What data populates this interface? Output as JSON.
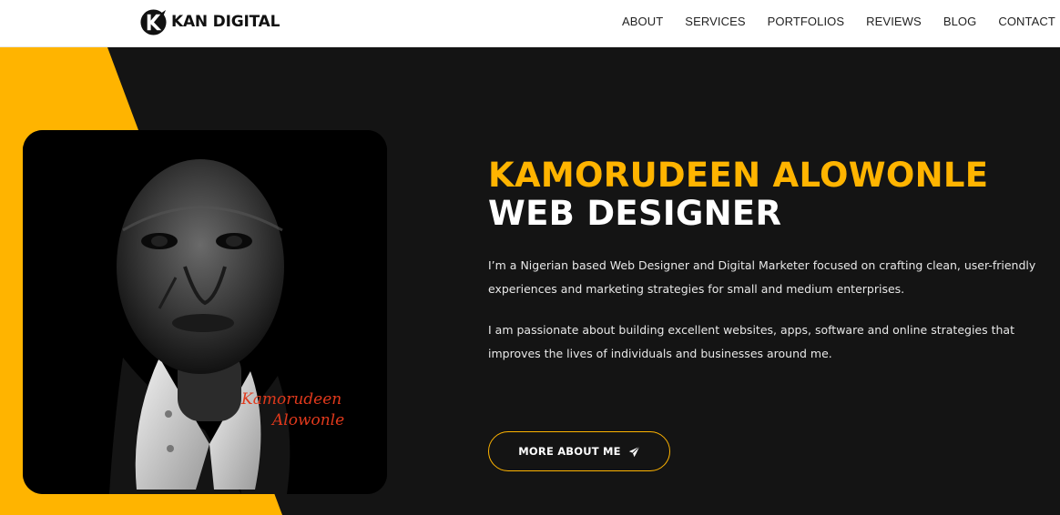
{
  "brand": {
    "name": "KAN DIGITAL",
    "accent": "#ffb400",
    "dark": "#141414",
    "logo_icon": "k-logo-icon"
  },
  "nav": {
    "items": [
      {
        "label": "ABOUT"
      },
      {
        "label": "SERVICES"
      },
      {
        "label": "PORTFOLIOS"
      },
      {
        "label": "REVIEWS"
      },
      {
        "label": "BLOG"
      },
      {
        "label": "CONTACT"
      }
    ]
  },
  "hero": {
    "name": "KAMORUDEEN ALOWONLE",
    "role": "WEB DESIGNER",
    "paragraphs": [
      "I’m a Nigerian based Web Designer and Digital Marketer focused on crafting clean, user-friendly experiences and marketing strategies for small and medium enterprises.",
      "I am passionate about building excellent websites, apps, software and online strategies that improves the lives of individuals and businesses around me."
    ],
    "signature": {
      "line1": "Kamorudeen",
      "line2": "Alowonle"
    },
    "cta": {
      "label": "MORE ABOUT ME",
      "icon": "paper-plane-icon"
    }
  }
}
